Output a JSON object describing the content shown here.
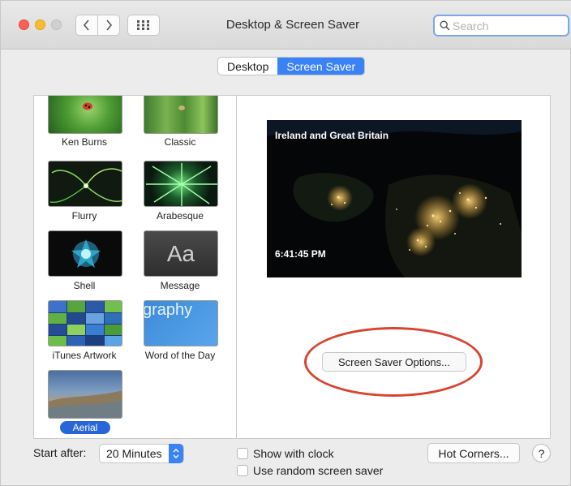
{
  "window": {
    "title": "Desktop & Screen Saver"
  },
  "search": {
    "placeholder": "Search"
  },
  "tabs": [
    {
      "label": "Desktop",
      "active": false
    },
    {
      "label": "Screen Saver",
      "active": true
    }
  ],
  "savers": [
    {
      "label": "Ken Burns"
    },
    {
      "label": "Classic"
    },
    {
      "label": "Flurry"
    },
    {
      "label": "Arabesque"
    },
    {
      "label": "Shell"
    },
    {
      "label": "Message",
      "thumb_text": "Aa"
    },
    {
      "label": "iTunes Artwork"
    },
    {
      "label": "Word of the Day",
      "thumb_text": "graphy"
    },
    {
      "label": "Aerial",
      "selected": true
    }
  ],
  "preview": {
    "location": "Ireland and Great Britain",
    "time": "6:41:45 PM"
  },
  "options_button": {
    "label": "Screen Saver Options..."
  },
  "footer": {
    "start_after_label": "Start after:",
    "start_after_value": "20 Minutes",
    "show_clock_label": "Show with clock",
    "random_label": "Use random screen saver",
    "hot_corners_label": "Hot Corners...",
    "help_label": "?"
  },
  "colors": {
    "accent": "#3a82f6",
    "selection": "#2866d8",
    "annotation": "#d8442f"
  }
}
